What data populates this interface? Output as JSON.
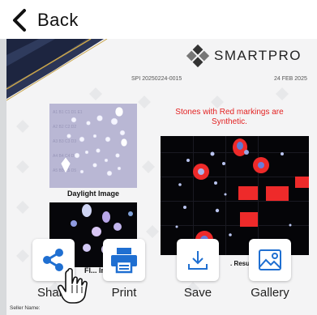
{
  "nav": {
    "back_label": "Back"
  },
  "report": {
    "brand": "SMARTPRO",
    "ref_no": "SPI 20250224-0015",
    "date": "24 FEB 2025",
    "warning": "Stones with Red markings are Synthetic.",
    "daylight_caption": "Daylight Image",
    "fluor_caption": "Fl... Image",
    "result_caption": ". Result",
    "seller_label": "Seller Name:"
  },
  "share_sheet": {
    "actions": [
      {
        "label": "Share",
        "icon": "share-icon"
      },
      {
        "label": "Print",
        "icon": "printer-icon"
      },
      {
        "label": "Save",
        "icon": "download-icon"
      },
      {
        "label": "Gallery",
        "icon": "image-icon"
      }
    ]
  },
  "colors": {
    "accent_blue": "#1f6fd1",
    "warning_red": "#e32222",
    "banner_navy": "#1d2540",
    "banner_gold": "#c9a54a"
  }
}
